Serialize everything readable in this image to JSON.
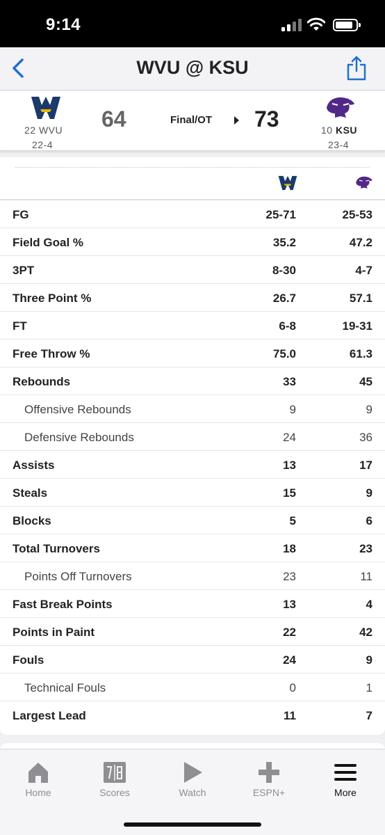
{
  "status_bar": {
    "time": "9:14"
  },
  "nav": {
    "title": "WVU @ KSU"
  },
  "game": {
    "away": {
      "rank": "22",
      "abbr": "WVU",
      "record": "22-4",
      "score": "64"
    },
    "home": {
      "rank": "10",
      "abbr": "KSU",
      "record": "23-4",
      "score": "73"
    },
    "status": "Final/OT"
  },
  "stats": [
    {
      "label": "FG",
      "away": "25-71",
      "home": "25-53"
    },
    {
      "label": "Field Goal %",
      "away": "35.2",
      "home": "47.2"
    },
    {
      "label": "3PT",
      "away": "8-30",
      "home": "4-7"
    },
    {
      "label": "Three Point %",
      "away": "26.7",
      "home": "57.1"
    },
    {
      "label": "FT",
      "away": "6-8",
      "home": "19-31"
    },
    {
      "label": "Free Throw %",
      "away": "75.0",
      "home": "61.3"
    },
    {
      "label": "Rebounds",
      "away": "33",
      "home": "45"
    },
    {
      "label": "Offensive Rebounds",
      "away": "9",
      "home": "9"
    },
    {
      "label": "Defensive Rebounds",
      "away": "24",
      "home": "36"
    },
    {
      "label": "Assists",
      "away": "13",
      "home": "17"
    },
    {
      "label": "Steals",
      "away": "15",
      "home": "9"
    },
    {
      "label": "Blocks",
      "away": "5",
      "home": "6"
    },
    {
      "label": "Total Turnovers",
      "away": "18",
      "home": "23"
    },
    {
      "label": "Points Off Turnovers",
      "away": "23",
      "home": "11"
    },
    {
      "label": "Fast Break Points",
      "away": "13",
      "home": "4"
    },
    {
      "label": "Points in Paint",
      "away": "22",
      "home": "42"
    },
    {
      "label": "Fouls",
      "away": "24",
      "home": "9"
    },
    {
      "label": "Technical Fouls",
      "away": "0",
      "home": "1"
    },
    {
      "label": "Largest Lead",
      "away": "11",
      "home": "7"
    }
  ],
  "tabs": [
    {
      "label": "Home",
      "icon": "house-icon"
    },
    {
      "label": "Scores",
      "icon": "scoreboard-icon"
    },
    {
      "label": "Watch",
      "icon": "play-icon"
    },
    {
      "label": "ESPN+",
      "icon": "plus-icon"
    },
    {
      "label": "More",
      "icon": "hamburger-icon"
    }
  ],
  "colors": {
    "accent": "#1f6fd1",
    "wvu_blue": "#1a3a6b",
    "ksu_purple": "#512888",
    "active_tab": "#111111",
    "inactive_tab": "#8e8e93"
  }
}
